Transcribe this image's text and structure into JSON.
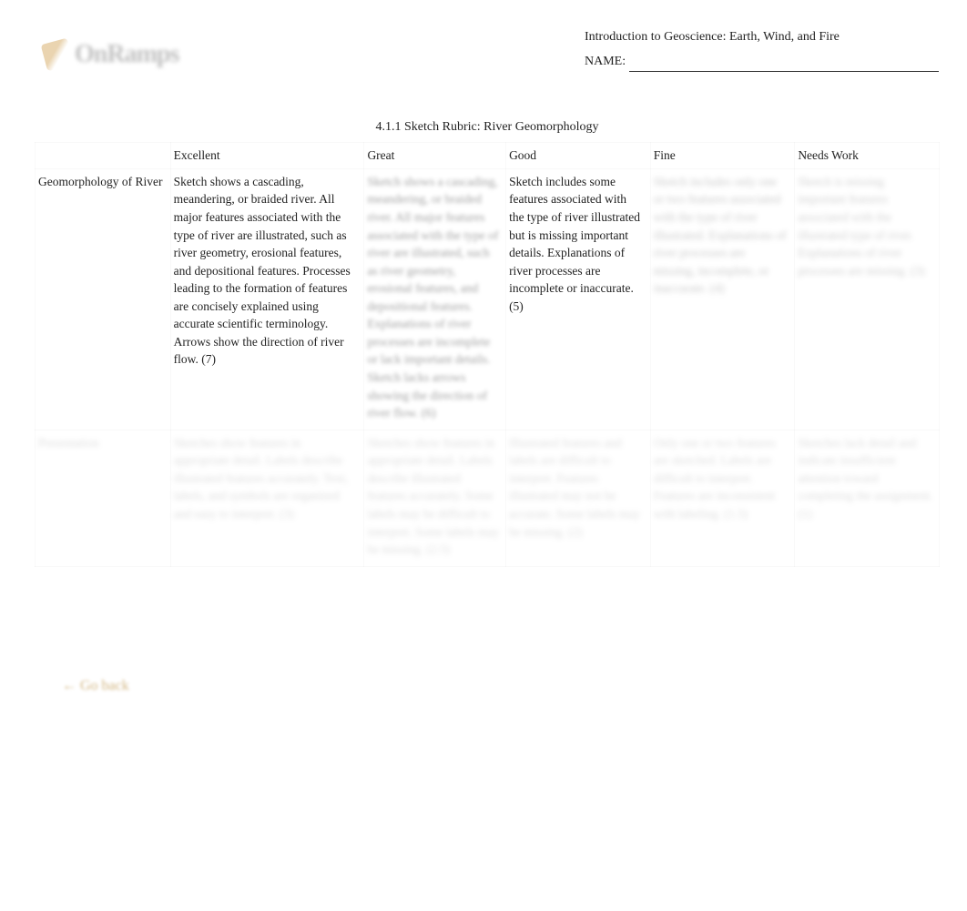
{
  "header": {
    "logo_text": "OnRamps",
    "course_title": "Introduction to Geoscience: Earth, Wind, and Fire",
    "name_label": "NAME:"
  },
  "rubric": {
    "caption": "4.1.1 Sketch Rubric: River Geomorphology",
    "blank_header": "",
    "columns": [
      "Excellent",
      "Great",
      "Good",
      "Fine",
      "Needs Work"
    ],
    "rows": [
      {
        "label": "Geomorphology of River",
        "cells": [
          "Sketch shows a cascading, meandering, or     braided river. All major features associated with  the type of river are illustrated, such as river geometry, erosional features, and depositional features. Processes leading to the formation of features are concisely explained using accurate    scientific terminology. Arrows show the direction of river flow. (7)",
          "Sketch shows a cascading, meandering, or braided river. All major features associated with the type of river are illustrated, such as river geometry, erosional features, and depositional features. Explanations of river processes are incomplete or lack important details. Sketch lacks arrows showing the direction of river flow. (6)",
          "Sketch includes some features associated with the type of river illustrated but is missing   important details. Explanations of river processes are incomplete or inaccurate. (5)",
          "Sketch includes only one or two features associated with the type of river illustrated. Explanations of river processes are missing, incomplete, or inaccurate. (4)",
          "Sketch is missing important features associated with the     illustrated type of river. Explanations of river processes are missing. (3)"
        ]
      },
      {
        "label": "Presentation",
        "cells": [
          "Sketches show features in appropriate detail. Labels describe illustrated features accurately. Text, labels, and symbols      are  organized and easy to interpret. (3)",
          "Sketches show features in appropriate  detail. Labels describe illustrated features accurately. Some labels may be difficult to interpret. Some labels may be missing. (2.5)",
          "Illustrated features and labels are difficult    to interpret. Features illustrated may not be accurate. Some labels may be missing. (2)",
          "Only one or two features are sketched. Labels are difficult to interpret. Features are inconsistent with labeling. (1.5)",
          "Sketches lack detail and indicate insufficient   attention toward completing the assignment. (1)"
        ]
      }
    ]
  },
  "footer": {
    "back_label": "← Go back"
  }
}
